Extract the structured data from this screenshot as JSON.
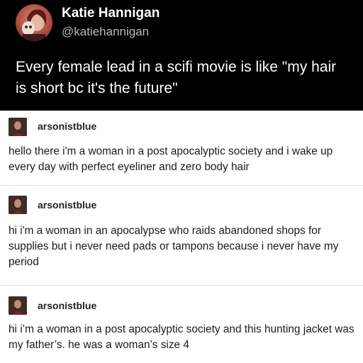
{
  "tweet": {
    "display_name": "Katie Hannigan",
    "handle": "@katiehannigan",
    "text": "Every female lead in a scifi movie is like \"my hair is short bc it's the future\""
  },
  "posts": [
    {
      "username": "arsonistblue",
      "text": "hello there i'm a woman in a post apocalyptic society and i wake up every day with perfect eyeliner and zero body hair"
    },
    {
      "username": "arsonistblue",
      "text": "hi i'm a woman in an apocalypse who raids abandoned shops for supplies but i never need pads or tampons because i never have my period"
    },
    {
      "username": "arsonistblue",
      "text": "hi i’m a woman in a post apocalyptic society and this hunting jacket was my father’s. he was a woman’s size 4"
    }
  ]
}
